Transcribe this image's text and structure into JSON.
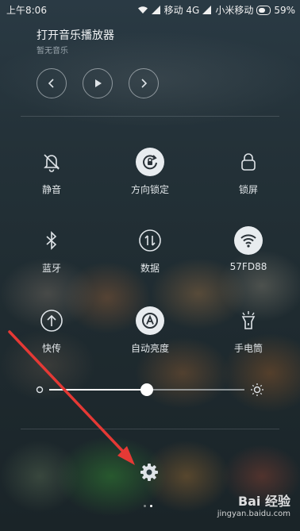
{
  "status_bar": {
    "time": "上午8:06",
    "carrier1": "移动 4G",
    "carrier2": "小米移动",
    "battery": "59%"
  },
  "music": {
    "title": "打开音乐播放器",
    "subtitle": "暂无音乐"
  },
  "tiles": [
    {
      "label": "静音",
      "icon": "bell-off-icon",
      "active": false
    },
    {
      "label": "方向锁定",
      "icon": "rotation-lock-icon",
      "active": true
    },
    {
      "label": "锁屏",
      "icon": "lock-icon",
      "active": false
    },
    {
      "label": "蓝牙",
      "icon": "bluetooth-icon",
      "active": false
    },
    {
      "label": "数据",
      "icon": "data-icon",
      "active": false
    },
    {
      "label": "57FD88",
      "icon": "wifi-icon",
      "active": true
    },
    {
      "label": "快传",
      "icon": "upload-icon",
      "active": false
    },
    {
      "label": "自动亮度",
      "icon": "auto-brightness-icon",
      "active": true
    },
    {
      "label": "手电筒",
      "icon": "flashlight-icon",
      "active": false
    }
  ],
  "brightness": {
    "level": 0.5
  },
  "page_indicator": {
    "count": 2,
    "active": 1
  },
  "watermark": {
    "main": "Bai 经验",
    "sub": "jingyan.baidu.com"
  },
  "colors": {
    "accent": "#ffffff",
    "arrow": "#e53935",
    "tile_active_bg": "#e8ecef"
  }
}
